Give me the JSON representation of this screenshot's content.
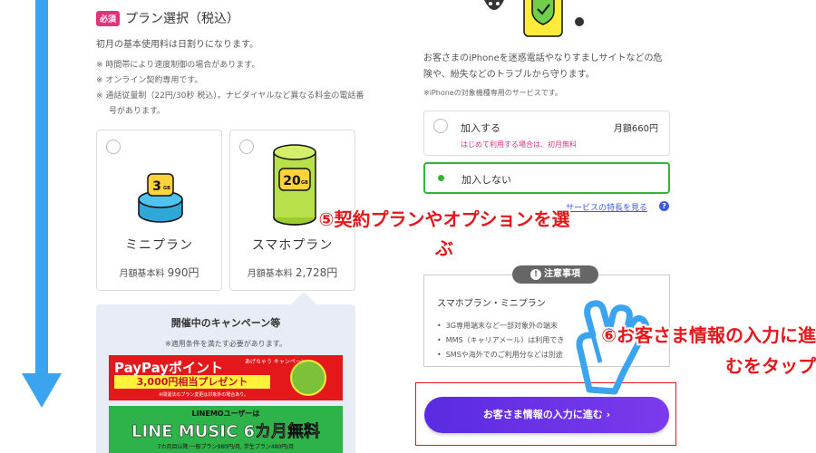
{
  "plan_section": {
    "badge": "必須",
    "title": "プラン選択（税込）",
    "note_main": "初月の基本使用料は日割りになります。",
    "notes": [
      "※ 時間帯により速度制御の場合があります。",
      "※ オンライン契約専用です。",
      "※ 通話従量制（22円/30秒 税込）。ナビダイヤルなど異なる料金の電話番号があります。"
    ],
    "plans": [
      {
        "capacity": "3",
        "unit": "GB",
        "name": "ミニプラン",
        "price_label": "月額基本料",
        "price": "990円"
      },
      {
        "capacity": "20",
        "unit": "GB",
        "name": "スマホプラン",
        "price_label": "月額基本料",
        "price": "2,728円"
      }
    ]
  },
  "campaign": {
    "title": "開催中のキャンペーン等",
    "note": "※適用条件を満たす必要があります。",
    "paypay": {
      "title": "PayPayポイント",
      "sub": "あげちゃう キャンペーン",
      "present": "3,000円相当プレゼント",
      "footnote": "※間違法のプラン変更は対象外の場合あり。"
    },
    "line_music": {
      "top": "LINEMOユーザーは",
      "main": "LINE MUSIC 6カ月無料",
      "foot": "7カ月目以降:一般プラン980円/月, 学生プラン480円/月"
    }
  },
  "option_section": {
    "description": "お客さまのiPhoneを迷惑電話やなりすましサイトなどの危険や、紛失などのトラブルから守ります。",
    "target": "※iPhoneの対象機種専用のサービスです。",
    "join": {
      "label": "加入する",
      "price": "月額660円",
      "note": "はじめて利用する場合は、初月無料"
    },
    "no_join": {
      "label": "加入しない"
    },
    "service_link": "サービスの特長を見る"
  },
  "caution": {
    "pill": "注意事項",
    "title": "スマホプラン・ミニプラン",
    "items": [
      "3G専用端末など一部対象外の端末",
      "MMS（キャリアメール）は利用でき",
      "SMSや海外でのご利用分などは別途"
    ]
  },
  "next_button": {
    "label": "お客さま情報の入力に進む ›"
  },
  "annotations": {
    "step5": "⑤契約プランやオプションを選ぶ",
    "step6": "⑥お客さま情報の入力に進むをタップ"
  },
  "colors": {
    "accent_blue": "#3ba4f0",
    "selected_green": "#35b534",
    "button_purple": "#6a33e8",
    "annotation_red": "#e4171a",
    "required_pink": "#e0337a"
  },
  "icons": [
    "scroll-down-arrow-icon",
    "shield-phone-icon",
    "sim-3gb-icon",
    "sim-20gb-icon",
    "help-icon",
    "tap-hand-icon"
  ]
}
